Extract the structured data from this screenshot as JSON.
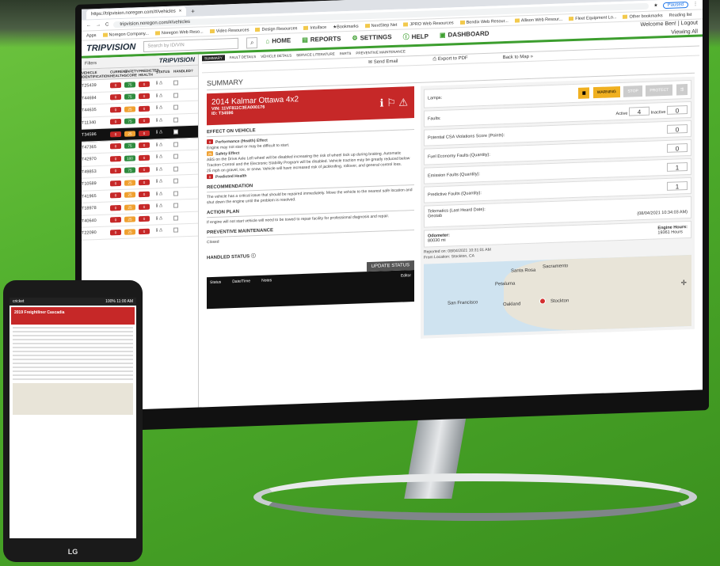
{
  "browser": {
    "tab_title": "https://tripvision.noregon.com/#/vehicles",
    "url": "tripvision.noregon.com/#/vehicles",
    "paused_label": "Paused",
    "bookmarks": [
      "Apps",
      "Noregon Company...",
      "Noregon Web Reso...",
      "Video Resources",
      "Design Resources",
      "Intuiface",
      "Bookmarks",
      "NextStep Net",
      "JPRO Web Resources",
      "Bendix Web Resour...",
      "Allison Web Resour...",
      "Fleet Equipment Lo...",
      "Other bookmarks",
      "Reading list"
    ]
  },
  "header": {
    "logo": "TRIPVISION",
    "search_placeholder": "Search by ID/VIN",
    "nav": [
      "HOME",
      "REPORTS",
      "SETTINGS",
      "HELP",
      "DASHBOARD"
    ],
    "welcome": "Welcome Ben! | Logout",
    "viewing": "Viewing All"
  },
  "sidebar": {
    "filters_label": "Filters",
    "logo": "TRIPVISION",
    "columns": [
      "VEHICLE IDENTIFICATION",
      "CURRENT HEALTH",
      "SAFETY SCORE",
      "PREDICTED HEALTH",
      "STATUS",
      "HANDLED?"
    ],
    "rows": [
      {
        "id": "T25439",
        "c": "0",
        "s": "75",
        "p": "0",
        "cc": "red",
        "sc": "green",
        "pc": "red"
      },
      {
        "id": "T44694",
        "c": "0",
        "s": "75",
        "p": "0",
        "cc": "red",
        "sc": "green",
        "pc": "red"
      },
      {
        "id": "T44635",
        "c": "0",
        "s": "25",
        "p": "0",
        "cc": "red",
        "sc": "orange",
        "pc": "red"
      },
      {
        "id": "T11340",
        "c": "0",
        "s": "75",
        "p": "0",
        "cc": "red",
        "sc": "green",
        "pc": "red"
      },
      {
        "id": "T34596",
        "c": "0",
        "s": "25",
        "p": "0",
        "cc": "red",
        "sc": "orange",
        "pc": "red"
      },
      {
        "id": "T47365",
        "c": "0",
        "s": "75",
        "p": "0",
        "cc": "red",
        "sc": "green",
        "pc": "red"
      },
      {
        "id": "T42970",
        "c": "0",
        "s": "100",
        "p": "0",
        "cc": "red",
        "sc": "green",
        "pc": "red"
      },
      {
        "id": "T49853",
        "c": "0",
        "s": "75",
        "p": "0",
        "cc": "red",
        "sc": "green",
        "pc": "red"
      },
      {
        "id": "T10589",
        "c": "0",
        "s": "25",
        "p": "0",
        "cc": "red",
        "sc": "orange",
        "pc": "red"
      },
      {
        "id": "T41965",
        "c": "0",
        "s": "25",
        "p": "0",
        "cc": "red",
        "sc": "orange",
        "pc": "red"
      },
      {
        "id": "T18978",
        "c": "0",
        "s": "25",
        "p": "0",
        "cc": "red",
        "sc": "orange",
        "pc": "red"
      },
      {
        "id": "T40640",
        "c": "0",
        "s": "25",
        "p": "0",
        "cc": "red",
        "sc": "orange",
        "pc": "red"
      },
      {
        "id": "T22090",
        "c": "0",
        "s": "25",
        "p": "0",
        "cc": "red",
        "sc": "orange",
        "pc": "red"
      }
    ]
  },
  "subtabs": [
    "SUMMARY",
    "FAULT DETAILS",
    "VEHICLE DETAILS",
    "SERVICE LITERATURE",
    "PARTS",
    "PREVENTIVE MAINTENANCE"
  ],
  "actions": [
    "Send Email",
    "Export to PDF",
    "Back to Map"
  ],
  "summary": {
    "title": "SUMMARY",
    "vehicle": "2014 Kalmar Ottawa 4x2",
    "vin": "VIN: 11VF811C3EA000176",
    "id": "ID: T34596",
    "effect_title": "EFFECT ON VEHICLE",
    "perf_label": "Performance (Health) Effect",
    "perf_text": "Engine may not start or may be difficult to start.",
    "safety_label": "Safety Effect",
    "safety_text": "ABS on the Drive Axle Left wheel will be disabled increasing the risk of wheel lock up during braking. Automatic Traction Control and the Electronic Stability Program will be disabled. Vehicle traction may be greatly reduced below 25 mph on gravel, ice, or snow. Vehicle will have increased risk of jackknifing, rollover, and general control loss.",
    "predicted_label": "Predicted Health",
    "rec_title": "RECOMMENDATION",
    "rec_text": "The vehicle has a critical issue that should be repaired immediately. Move the vehicle to the nearest safe location and shut down the engine until the problem is resolved.",
    "action_title": "ACTION PLAN",
    "action_text": "If engine will not start vehicle will need to be towed to repair facility for professional diagnosis and repair.",
    "pm_title": "PREVENTIVE MAINTENANCE",
    "pm_text": "Closed",
    "handled_title": "HANDLED STATUS",
    "update_btn": "UPDATE STATUS",
    "table_cols": [
      "Status",
      "Date/Time",
      "Notes",
      "Editor"
    ]
  },
  "right": {
    "lamps_label": "Lamps:",
    "lamps": [
      "WARNING",
      "STOP",
      "PROTECT"
    ],
    "faults_label": "Faults:",
    "active_label": "Active",
    "active": "4",
    "inactive_label": "Inactive",
    "inactive": "0",
    "csa_label": "Potential CSA Violations Score (Points):",
    "csa": "0",
    "fuel_label": "Fuel Economy Faults (Quantity):",
    "fuel": "0",
    "emission_label": "Emission Faults (Quantity):",
    "emission": "1",
    "predictive_label": "Predictive Faults (Quantity):",
    "predictive": "1",
    "telematics_label": "Telematics (Last Heard Date):",
    "telematics_src": "Geotab",
    "telematics_date": "(08/04/2021 10:34:03 AM)",
    "odometer_label": "Odometer:",
    "odometer": "80030 mi",
    "hours_label": "Engine Hours:",
    "hours": "19361 Hours",
    "reported": "Reported on: 08/04/2021 10:31:01 AM",
    "location": "From Location: Stockton, CA",
    "map_cities": [
      "Santa Rosa",
      "Sacramento",
      "Petaluma",
      "San Francisco",
      "Oakland",
      "Stockton"
    ]
  },
  "phone": {
    "carrier": "cricket",
    "status": "100% 11:00 AM",
    "vehicle": "2019 Freightliner Cascadia",
    "brand": "LG"
  }
}
